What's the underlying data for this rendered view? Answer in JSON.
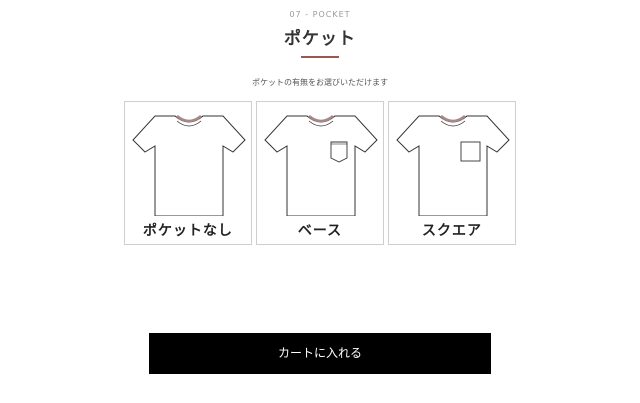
{
  "step_label": "07 - POCKET",
  "title": "ポケット",
  "instruction": "ポケットの有無をお選びいただけます",
  "options": [
    {
      "label": "ポケットなし",
      "icon": "tshirt-no-pocket-icon"
    },
    {
      "label": "ベース",
      "icon": "tshirt-base-pocket-icon"
    },
    {
      "label": "スクエア",
      "icon": "tshirt-square-pocket-icon"
    }
  ],
  "cart_button": {
    "label": "カートに入れる"
  },
  "colors": {
    "accent": "#a05555",
    "button_bg": "#000000",
    "border": "#cfcfcf"
  }
}
